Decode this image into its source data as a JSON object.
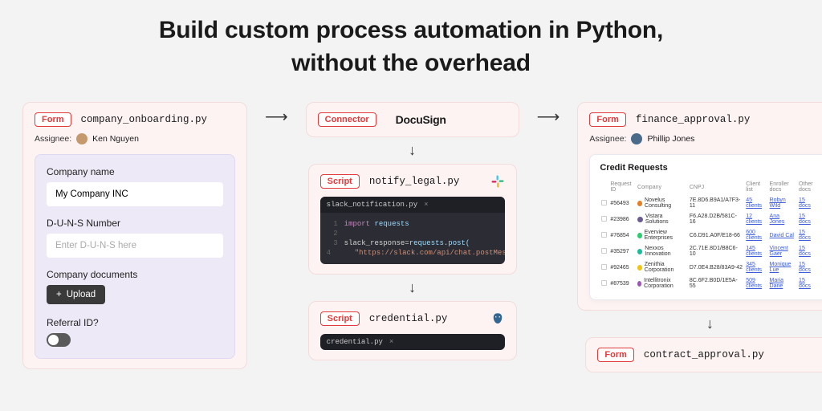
{
  "hero": {
    "line1": "Build custom process automation in Python,",
    "line2": "without the overhead"
  },
  "tags": {
    "form": "Form",
    "connector": "Connector",
    "script": "Script"
  },
  "form1": {
    "filename": "company_onboarding.py",
    "assignee_label": "Assignee:",
    "assignee_name": "Ken Nguyen",
    "company_label": "Company name",
    "company_value": "My Company INC",
    "duns_label": "D-U-N-S Number",
    "duns_placeholder": "Enter D-U-N-S here",
    "docs_label": "Company documents",
    "upload_btn": "Upload",
    "referral_label": "Referral ID?"
  },
  "connector": {
    "brand": "DocuSign"
  },
  "script1": {
    "filename": "notify_legal.py",
    "tab": "slack_notification.py",
    "line1_kw": "import",
    "line1_lib": "requests",
    "line3_var": "slack_response",
    "line3_eq": " = ",
    "line3_call": "requests.post(",
    "line4_str": "\"https://slack.com/api/chat.postMessage\""
  },
  "script2": {
    "filename": "credential.py",
    "tab": "credential.py"
  },
  "form2": {
    "filename": "finance_approval.py",
    "assignee_label": "Assignee:",
    "assignee_name": "Phillip Jones",
    "table_title": "Credit Requests",
    "headers": {
      "id": "Request ID",
      "company": "Company",
      "cnpj": "CNPJ",
      "clients": "Client list",
      "enroller": "Enroller docs",
      "other": "Other docs"
    },
    "rows": [
      {
        "id": "#56493",
        "company": "Novelus Consulting",
        "color": "#e67e22",
        "cnpj": "7E.8D6.B9A1/A7F3-11",
        "clients": "45 clients",
        "enroller": "Robyn Wild",
        "other": "15 docs"
      },
      {
        "id": "#23986",
        "company": "Vistara Solutions",
        "color": "#6b5b95",
        "cnpj": "F6.A28.D2B/581C-16",
        "clients": "12 clients",
        "enroller": "Ana Jones",
        "other": "15 docs"
      },
      {
        "id": "#76854",
        "company": "Everview Enterprises",
        "color": "#2ecc71",
        "cnpj": "C6.D91.A0F/E18-66",
        "clients": "600 clients",
        "enroller": "David Cal",
        "other": "15 docs"
      },
      {
        "id": "#35297",
        "company": "Nexxos Innovation",
        "color": "#1abc9c",
        "cnpj": "2C.71E.8D1/B8C6-10",
        "clients": "145 clients",
        "enroller": "Vincent Gaer",
        "other": "15 docs"
      },
      {
        "id": "#92465",
        "company": "Zenithia Corporation",
        "color": "#f1c40f",
        "cnpj": "D7.0E4.B28/83A9-42",
        "clients": "345 clients",
        "enroller": "Monique Lue",
        "other": "15 docs"
      },
      {
        "id": "#87539",
        "company": "Intellitronix Corporation",
        "color": "#9b59b6",
        "cnpj": "8C.6F2.B0D/1E5A-55",
        "clients": "509 clients",
        "enroller": "Maria Dane",
        "other": "15 docs"
      }
    ]
  },
  "form3": {
    "filename": "contract_approval.py"
  }
}
